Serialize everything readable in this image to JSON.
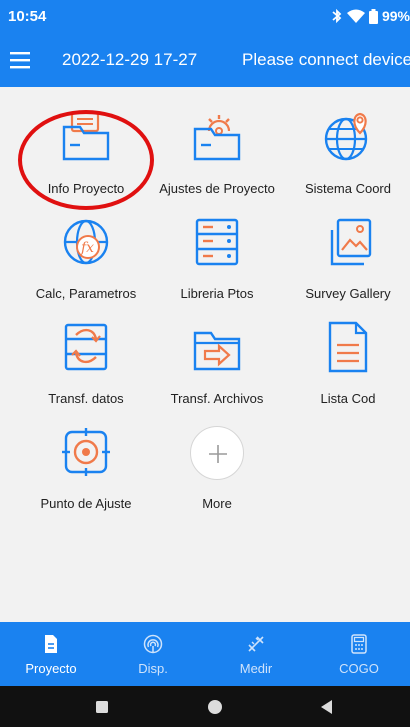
{
  "status_bar": {
    "time": "10:54",
    "battery": "99",
    "battery_suffix": "%",
    "icons": [
      "bluetooth-icon",
      "wifi-icon",
      "battery-icon"
    ]
  },
  "app_bar": {
    "datetime": "2022-12-29 17-27",
    "connection_status": "Please connect device",
    "menu_icon": "hamburger-menu-icon"
  },
  "grid": {
    "items": [
      {
        "label": "Info Proyecto",
        "icon": "folder-document-icon"
      },
      {
        "label": "Ajustes de Proyecto",
        "icon": "folder-gear-icon"
      },
      {
        "label": "Sistema Coord",
        "icon": "globe-pin-icon"
      },
      {
        "label": "Calc, Parametros",
        "icon": "globe-fx-icon"
      },
      {
        "label": "Libreria Ptos",
        "icon": "cabinet-icon"
      },
      {
        "label": "Survey Gallery",
        "icon": "gallery-icon"
      },
      {
        "label": "Transf. datos",
        "icon": "data-transfer-icon"
      },
      {
        "label": "Transf. Archivos",
        "icon": "folder-arrow-icon"
      },
      {
        "label": "Lista Cod",
        "icon": "document-list-icon"
      },
      {
        "label": "Punto de Ajuste",
        "icon": "target-icon"
      },
      {
        "label": "More",
        "icon": "plus-icon"
      }
    ],
    "highlighted": "Info Proyecto"
  },
  "tab_bar": {
    "tabs": [
      {
        "label": "Proyecto",
        "icon": "project-file-icon",
        "active": true
      },
      {
        "label": "Disp.",
        "icon": "device-signal-icon",
        "active": false
      },
      {
        "label": "Medir",
        "icon": "measure-icon",
        "active": false
      },
      {
        "label": "COGO",
        "icon": "calculator-icon",
        "active": false
      }
    ]
  },
  "system_nav": {
    "buttons": [
      "recents-square-icon",
      "home-circle-icon",
      "back-triangle-icon"
    ]
  },
  "colors": {
    "primary": "#1a82f0",
    "accent_orange": "#f07a4a",
    "grid_background": "#f2f2f2",
    "highlight": "#e01010"
  }
}
